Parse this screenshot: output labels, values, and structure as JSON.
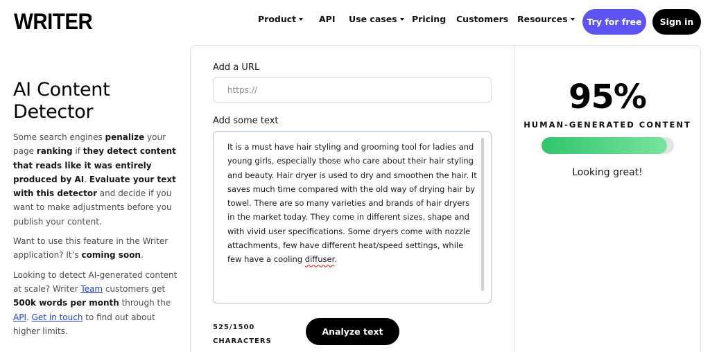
{
  "nav": {
    "logo": "WRITER",
    "items": [
      {
        "label": "Product",
        "dropdown": true
      },
      {
        "label": "API",
        "dropdown": false
      },
      {
        "label": "Use cases",
        "dropdown": true
      },
      {
        "label": "Pricing",
        "dropdown": false
      },
      {
        "label": "Customers",
        "dropdown": false
      },
      {
        "label": "Resources",
        "dropdown": true
      }
    ],
    "try_label": "Try for free",
    "signin_label": "Sign in"
  },
  "colors": {
    "accent": "#5C55F4",
    "dark": "#000000",
    "meter_green": "#2fc66b",
    "link": "#1e40d8"
  },
  "intro": {
    "title_line1": "AI Content",
    "title_line2": "Detector",
    "p1": {
      "t1": "Some search engines ",
      "b1": "penalize",
      "t2": " your page ",
      "b2": "ranking",
      "t3": " if ",
      "b3": "they detect content that reads like it was entirely produced by AI",
      "t4": ". ",
      "b4": "Evaluate your text with this detector",
      "t5": " and decide if you want to make adjustments before you publish your content."
    },
    "p2": {
      "t1": "Want to use this feature in the Writer application? It’s ",
      "b1": "coming soon",
      "t2": "."
    },
    "p3": {
      "t1": "Looking to detect AI-generated content at scale? Writer ",
      "link1": "Team",
      "t2": " customers get ",
      "b1": "500k words per month",
      "t3": " through the ",
      "link2": "API",
      "t4": ". ",
      "link3": "Get in touch",
      "t5": " to find out about higher limits."
    }
  },
  "form": {
    "url_label": "Add a URL",
    "url_placeholder": "https://",
    "url_value": "",
    "text_label": "Add some text",
    "text_value_main": " It is a must have hair styling and grooming tool for ladies and young girls, especially those who care about their hair styling and beauty. Hair dryer is used to dry and smoothen the hair. It saves much time compared with the old way of drying hair by towel. There are so many varieties and brands of hair dryers in the market today. They come in different sizes, shape and with vivid user specifications. Some dryers come with nozzle attachments, few have different heat/speed settings, while few have a cooling ",
    "text_value_misspelled": "diffuser",
    "text_value_end": ".",
    "char_count": "525/1500",
    "char_unit": "CHARACTERS",
    "analyze_label": "Analyze text"
  },
  "result": {
    "percent": "95%",
    "label": "HUMAN-GENERATED CONTENT",
    "meter_fraction": 0.95,
    "verdict": "Looking great!"
  }
}
